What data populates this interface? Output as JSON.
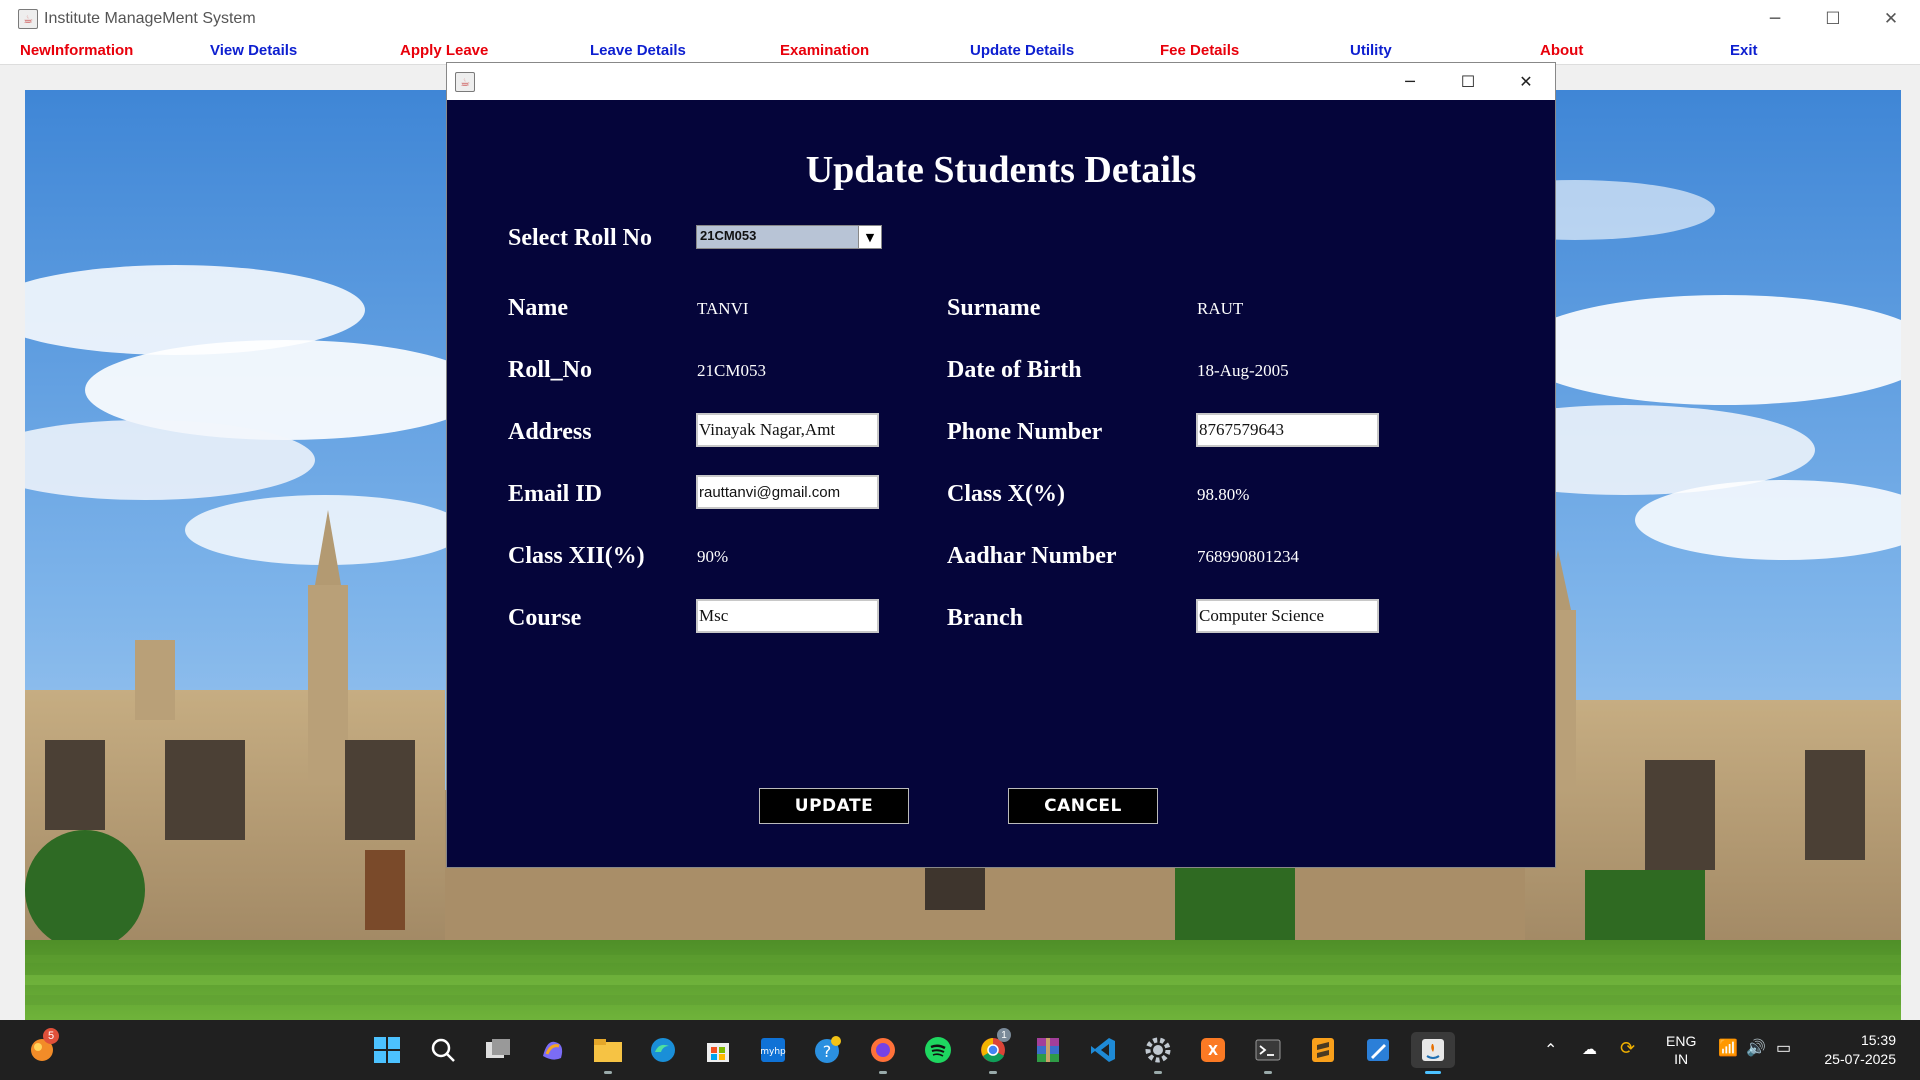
{
  "window": {
    "title": "Institute ManageMent System",
    "minimize": "─",
    "maximize": "☐",
    "close": "✕"
  },
  "menu": [
    {
      "label": "NewInformation",
      "color": "red"
    },
    {
      "label": "View Details",
      "color": "blue"
    },
    {
      "label": "Apply Leave",
      "color": "red"
    },
    {
      "label": "Leave Details",
      "color": "blue"
    },
    {
      "label": "Examination",
      "color": "red"
    },
    {
      "label": "Update Details",
      "color": "blue"
    },
    {
      "label": "Fee Details",
      "color": "red"
    },
    {
      "label": "Utility",
      "color": "blue"
    },
    {
      "label": "About",
      "color": "red"
    },
    {
      "label": "Exit",
      "color": "blue"
    }
  ],
  "dialog": {
    "heading": "Update Students Details",
    "select_roll_label": "Select Roll No",
    "select_roll_value": "21CM053",
    "labels": {
      "name": "Name",
      "surname": "Surname",
      "roll_no": "Roll_No",
      "dob": "Date of Birth",
      "address": "Address",
      "phone": "Phone Number",
      "email": "Email ID",
      "class_x": "Class X(%)",
      "class_xii": "Class XII(%)",
      "aadhar": "Aadhar Number",
      "course": "Course",
      "branch": "Branch"
    },
    "values": {
      "name": "TANVI",
      "surname": "RAUT",
      "roll_no": "21CM053",
      "dob": "18-Aug-2005",
      "address": "Vinayak Nagar,Amt",
      "phone": "8767579643",
      "email": "rauttanvi@gmail.com",
      "class_x": "98.80%",
      "class_xii": "90%",
      "aadhar": "768990801234",
      "course": "Msc",
      "branch": "Computer Science"
    },
    "update_button": "UPDATE",
    "cancel_button": "CANCEL"
  },
  "taskbar": {
    "notification_badge": "5",
    "chrome_badge": "1",
    "language": "ENG",
    "region": "IN",
    "time": "15:39",
    "date": "25-07-2025",
    "apps": [
      "start-icon",
      "search-icon",
      "task-view-icon",
      "copilot-icon",
      "file-explorer-icon",
      "edge-icon",
      "store-icon",
      "myhp-icon",
      "help-icon",
      "firefox-icon",
      "spotify-icon",
      "chrome-icon",
      "winrar-icon",
      "vscode-icon",
      "settings-icon",
      "xampp-icon",
      "terminal-icon",
      "sublime-icon",
      "paint-icon",
      "java-icon"
    ]
  },
  "colors": {
    "dialog_bg": "#05053a",
    "menu_red": "#e8000b",
    "menu_blue": "#0d1fd0",
    "taskbar_bg": "#202020"
  }
}
